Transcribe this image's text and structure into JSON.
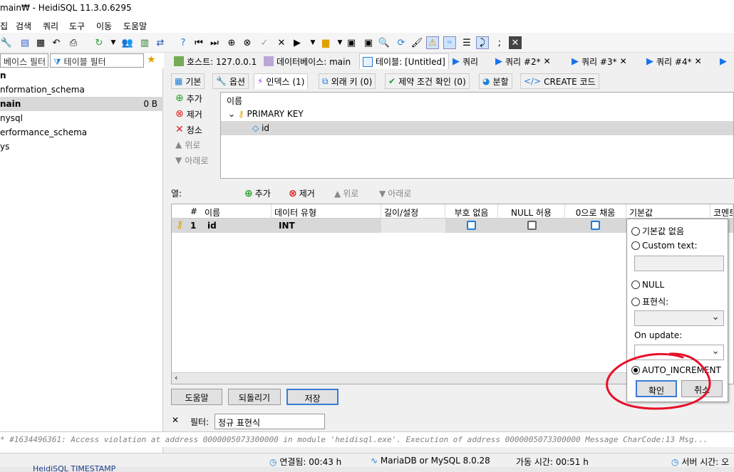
{
  "window": {
    "title": "main₩ - HeidiSQL 11.3.0.6295"
  },
  "menu": [
    "집",
    "검색",
    "쿼리",
    "도구",
    "이동",
    "도움말"
  ],
  "filters": {
    "db_filter": "베이스 필터",
    "table_filter": "테이블 필터"
  },
  "tree": {
    "items": [
      {
        "label": "n"
      },
      {
        "label": "nformation_schema"
      },
      {
        "label": "nain",
        "size": "0 B"
      },
      {
        "label": "nysql"
      },
      {
        "label": "erformance_schema"
      },
      {
        "label": "ys"
      }
    ]
  },
  "main_tabs": [
    {
      "label": "호스트: 127.0.0.1"
    },
    {
      "label": "데이터베이스: main"
    },
    {
      "label": "테이블: [Untitled]"
    },
    {
      "label": "쿼리"
    },
    {
      "label": "쿼리 #2*"
    },
    {
      "label": "쿼리 #3*"
    },
    {
      "label": "쿼리 #4*"
    }
  ],
  "sub_tabs": [
    {
      "label": "기본"
    },
    {
      "label": "옵션"
    },
    {
      "label": "인덱스 (1)"
    },
    {
      "label": "외래 키 (0)"
    },
    {
      "label": "제약 조건 확인 (0)"
    },
    {
      "label": "분할"
    },
    {
      "label": "CREATE 코드"
    }
  ],
  "index_actions": {
    "add": "추가",
    "remove": "제거",
    "clear": "청소",
    "up": "위로",
    "down": "아래로"
  },
  "index_tree": {
    "header": "이름",
    "key": "PRIMARY KEY",
    "column": "id"
  },
  "columns_bar": {
    "label": "열:",
    "add": "추가",
    "remove": "제거",
    "up": "위로",
    "down": "아래로"
  },
  "grid": {
    "headers": [
      "#",
      "이름",
      "데이터 유형",
      "길이/설정",
      "부호 없음",
      "NULL 허용",
      "0으로 채움",
      "기본값",
      "코멘트"
    ],
    "rows": [
      {
        "num": "1",
        "name": "id",
        "type": "INT"
      }
    ]
  },
  "bottom_buttons": {
    "help": "도움말",
    "revert": "되돌리기",
    "save": "저장"
  },
  "filterbar": {
    "close": "✕",
    "label": "필터:",
    "placeholder": "정규 표현식"
  },
  "log": {
    "text": "* #1634496361: Access violation at address 0000005073300000 in module 'heidisql.exe'. Execution of address 0000005073300000 Message CharCode:13 Msg..."
  },
  "status": {
    "connected": "연결됨: 00:43 h",
    "server": "MariaDB or MySQL 8.0.28",
    "uptime": "가동 시간: 00:51 h",
    "server_time": "서버 시간: 오",
    "bottom_fragment": "HeidiSQL TIMESTAMP"
  },
  "default_popup": {
    "no_default": "기본값 없음",
    "custom_text": "Custom text:",
    "null": "NULL",
    "expression": "표현식:",
    "on_update": "On update:",
    "auto_increment": "AUTO_INCREMENT",
    "ok": "확인",
    "cancel": "취소",
    "selected": "AUTO_INCREMENT"
  },
  "colors": {
    "accent": "#1e7fd6",
    "key": "#e0a000",
    "annotation": "#e8102a"
  }
}
